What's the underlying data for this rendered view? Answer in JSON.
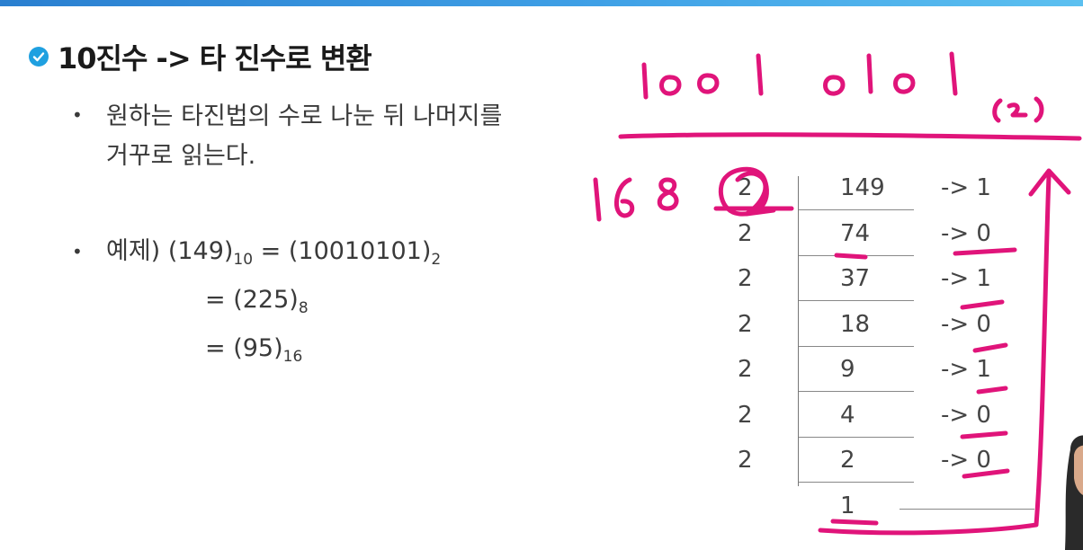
{
  "slide": {
    "title": "10진수 -> 타 진수로 변환",
    "bullet1": [
      "원하는 타진법의 수로 나눈 뒤 나머지를",
      "거꾸로 읽는다."
    ],
    "example": {
      "label": "예제)",
      "lhs": "(149)",
      "lhs_sub": "10",
      "rows": [
        {
          "prefix": "= (10010101)",
          "sub": "2"
        },
        {
          "prefix": "= (225)",
          "sub": "8"
        },
        {
          "prefix": "= (95)",
          "sub": "16"
        }
      ]
    }
  },
  "division_table": {
    "divisors": [
      "2",
      "2",
      "2",
      "2",
      "2",
      "2",
      "2"
    ],
    "quotients": [
      "149",
      "74",
      "37",
      "18",
      "9",
      "4",
      "2",
      "1"
    ],
    "remainders": [
      "-> 1",
      "-> 0",
      "-> 1",
      "-> 0",
      "-> 1",
      "-> 0",
      "-> 0"
    ]
  },
  "handwriting": {
    "result": "1001 0101",
    "result_base": "(2)",
    "side_note": "16 8",
    "ink_color": "#e0147a"
  }
}
